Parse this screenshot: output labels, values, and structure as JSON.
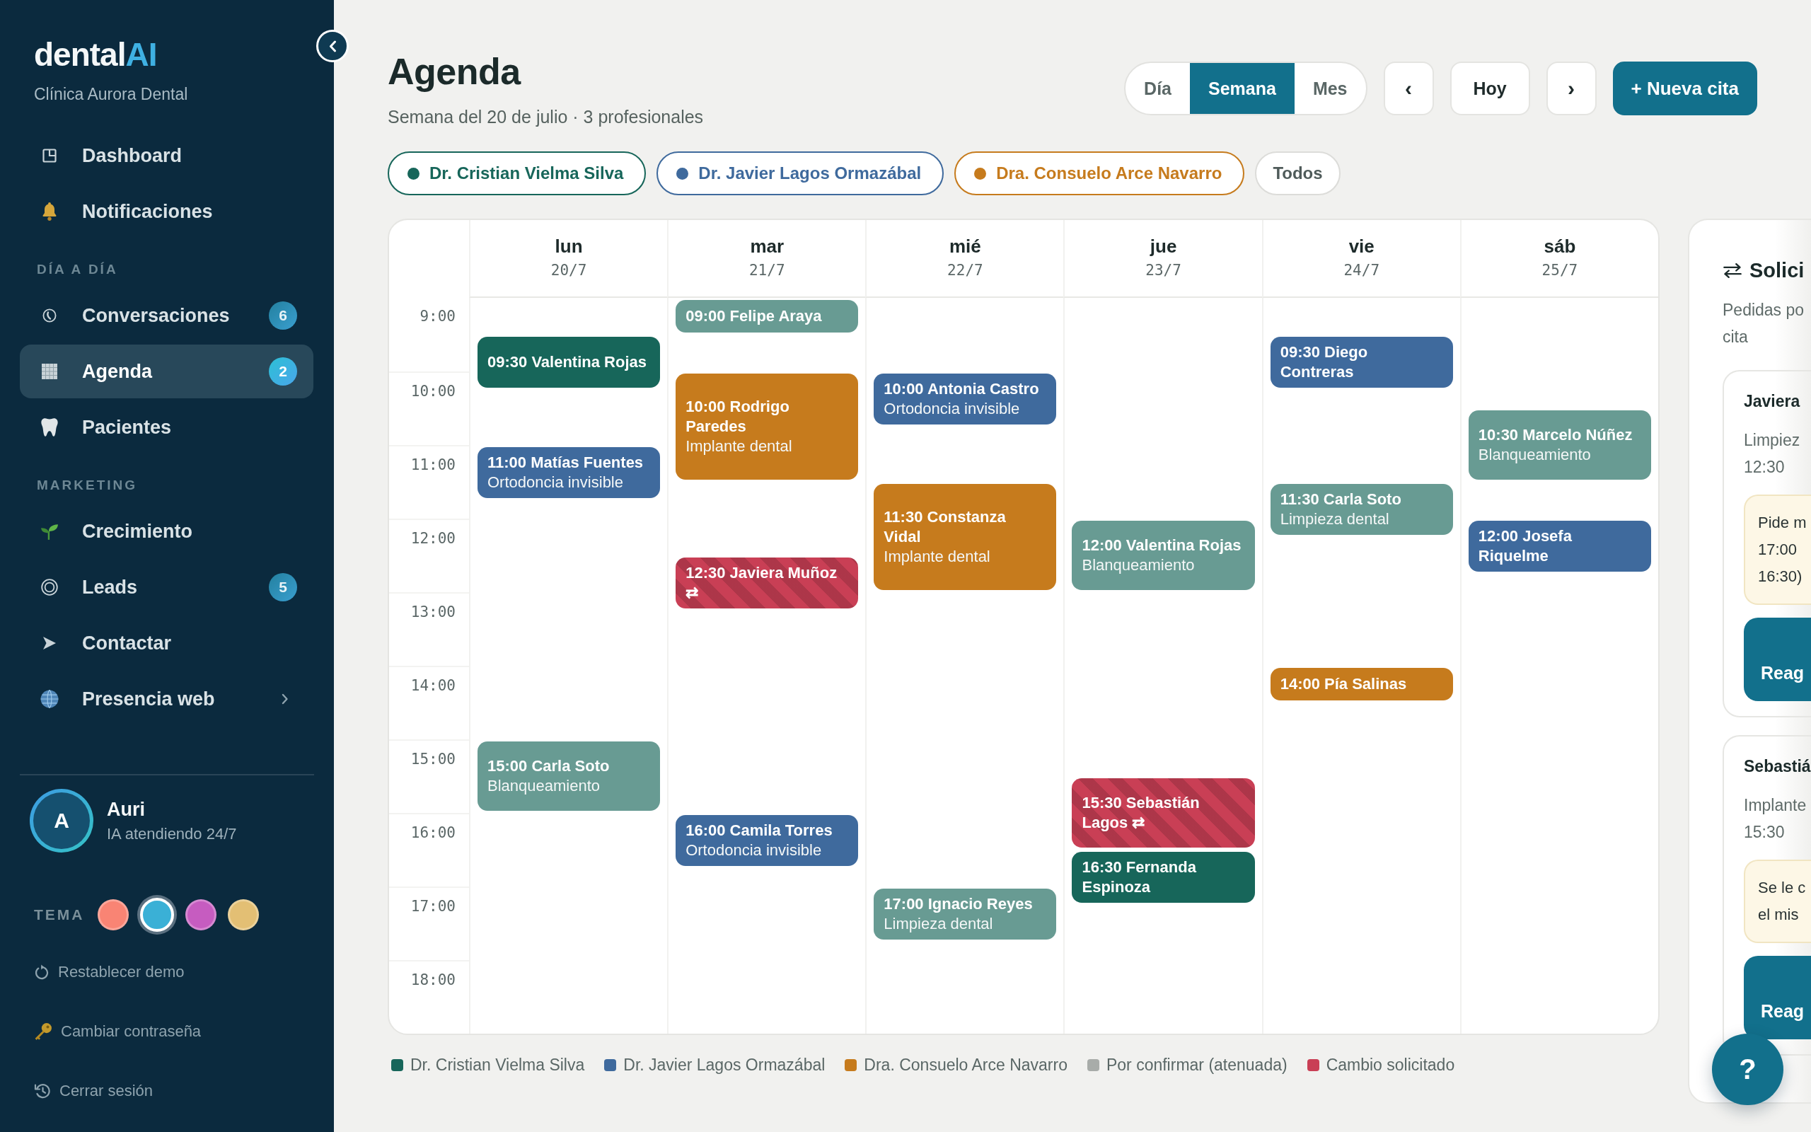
{
  "sidebar": {
    "logo": {
      "text": "dental",
      "accent": "AI"
    },
    "clinic": "Clínica Aurora Dental",
    "nav": [
      {
        "items": [
          {
            "label": "Dashboard",
            "selected": false,
            "submenu": false
          },
          {
            "label": "Notificaciones",
            "selected": false,
            "submenu": false
          }
        ]
      },
      {
        "label": "DÍA A DÍA",
        "items": [
          {
            "label": "Conversaciones",
            "badge": "6",
            "selected": false,
            "submenu": false
          },
          {
            "label": "Agenda",
            "badge": "2",
            "selected": true,
            "submenu": false
          },
          {
            "label": "Pacientes",
            "selected": false,
            "submenu": false
          }
        ]
      },
      {
        "label": "MARKETING",
        "items": [
          {
            "label": "Crecimiento",
            "selected": false,
            "submenu": false
          },
          {
            "label": "Leads",
            "badge": "5",
            "selected": false,
            "submenu": false
          },
          {
            "label": "Contactar",
            "selected": false,
            "submenu": false
          },
          {
            "label": "Presencia web",
            "selected": false,
            "submenu": true
          }
        ]
      }
    ],
    "profile": {
      "initial": "A",
      "name": "Auri",
      "status": "IA atendiendo 24/7"
    },
    "theme": {
      "label": "TEMA",
      "swatches": [
        {
          "color": "#f98474",
          "selected": false
        },
        {
          "color": "#3ab0d6",
          "selected": true
        },
        {
          "color": "#c65cc0",
          "selected": false
        },
        {
          "color": "#e3bf74",
          "selected": false
        }
      ]
    },
    "links": [
      {
        "label": "Restablecer demo"
      },
      {
        "label": "Cambiar contraseña"
      },
      {
        "label": "Cerrar sesión"
      }
    ]
  },
  "header": {
    "title": "Agenda",
    "subtitle": "Semana del 20 de julio · 3 profesionales",
    "views": [
      {
        "label": "Día",
        "selected": false
      },
      {
        "label": "Semana",
        "selected": true
      },
      {
        "label": "Mes",
        "selected": false
      }
    ],
    "prev": "‹",
    "today": "Hoy",
    "next": "›",
    "new_appointment": "+ Nueva cita"
  },
  "filters": [
    {
      "label": "Dr. Cristian Vielma Silva",
      "color": "#17665a",
      "selected": true
    },
    {
      "label": "Dr. Javier Lagos Ormazábal",
      "color": "#3f6a9d",
      "selected": true
    },
    {
      "label": "Dra. Consuelo Arce Navarro",
      "color": "#c67b1d",
      "selected": true
    },
    {
      "label": "Todos",
      "selected": false
    }
  ],
  "calendar": {
    "hours": [
      "9:00",
      "10:00",
      "11:00",
      "12:00",
      "13:00",
      "14:00",
      "15:00",
      "16:00",
      "17:00",
      "18:00"
    ],
    "days": [
      {
        "name": "lun",
        "date": "20/7",
        "events": [
          {
            "time": "09:30",
            "patient": "Valentina Rojas",
            "kind": "medium",
            "color": "#17665a",
            "change_requested": false
          },
          {
            "time": "11:00",
            "patient": "Matías Fuentes",
            "treatment": "Ortodoncia invisible",
            "kind": "medium",
            "color": "#3f6a9d",
            "change_requested": false
          },
          {
            "time": "15:00",
            "patient": "Carla Soto",
            "treatment": "Blanqueamiento",
            "kind": "long",
            "color": "#689b93",
            "change_requested": false
          }
        ]
      },
      {
        "name": "mar",
        "date": "21/7",
        "events": [
          {
            "time": "09:00",
            "patient": "Felipe Araya",
            "kind": "short",
            "color": "#689b93",
            "change_requested": false
          },
          {
            "time": "10:00",
            "patient": "Rodrigo Paredes",
            "treatment": "Implante dental",
            "kind": "extended",
            "color": "#c67b1d",
            "change_requested": false
          },
          {
            "time": "12:30",
            "patient": "Javiera Muñoz",
            "flag": "⇄",
            "kind": "medium",
            "color": "#c93f55",
            "change_requested": true
          },
          {
            "time": "16:00",
            "patient": "Camila Torres",
            "treatment": "Ortodoncia invisible",
            "kind": "medium",
            "color": "#3f6a9d",
            "change_requested": false
          }
        ]
      },
      {
        "name": "mié",
        "date": "22/7",
        "events": [
          {
            "time": "10:00",
            "patient": "Antonia Castro",
            "treatment": "Ortodoncia invisible",
            "kind": "medium",
            "color": "#3f6a9d",
            "change_requested": false
          },
          {
            "time": "11:30",
            "patient": "Constanza Vidal",
            "treatment": "Implante dental",
            "kind": "extended",
            "color": "#c67b1d",
            "change_requested": false
          },
          {
            "time": "17:00",
            "patient": "Ignacio Reyes",
            "treatment": "Limpieza dental",
            "kind": "medium",
            "color": "#689b93",
            "change_requested": false
          }
        ]
      },
      {
        "name": "jue",
        "date": "23/7",
        "events": [
          {
            "time": "12:00",
            "patient": "Valentina Rojas",
            "treatment": "Blanqueamiento",
            "kind": "long",
            "color": "#689b93",
            "change_requested": false
          },
          {
            "time": "15:30",
            "patient": "Sebastián Lagos",
            "flag": "⇄",
            "kind": "long",
            "color": "#c93f55",
            "change_requested": true
          },
          {
            "time": "16:30",
            "patient": "Fernanda Espinoza",
            "kind": "medium",
            "color": "#17665a",
            "change_requested": false
          }
        ]
      },
      {
        "name": "vie",
        "date": "24/7",
        "events": [
          {
            "time": "09:30",
            "patient": "Diego Contreras",
            "kind": "medium",
            "color": "#3f6a9d",
            "change_requested": false
          },
          {
            "time": "11:30",
            "patient": "Carla Soto",
            "treatment": "Limpieza dental",
            "kind": "medium",
            "color": "#689b93",
            "change_requested": false
          },
          {
            "time": "14:00",
            "patient": "Pía Salinas",
            "kind": "short",
            "color": "#c67b1d",
            "change_requested": false
          }
        ]
      },
      {
        "name": "sáb",
        "date": "25/7",
        "events": [
          {
            "time": "10:30",
            "patient": "Marcelo Núñez",
            "treatment": "Blanqueamiento",
            "kind": "long",
            "color": "#689b93",
            "change_requested": false
          },
          {
            "time": "12:00",
            "patient": "Josefa Riquelme",
            "kind": "medium",
            "color": "#3f6a9d",
            "change_requested": false
          }
        ]
      }
    ]
  },
  "legend": [
    {
      "label": "Dr. Cristian Vielma Silva",
      "color": "#17665a"
    },
    {
      "label": "Dr. Javier Lagos Ormazábal",
      "color": "#3f6a9d"
    },
    {
      "label": "Dra. Consuelo Arce Navarro",
      "color": "#c67b1d"
    },
    {
      "label": "Por confirmar (atenuada)",
      "color": "#a8aca9"
    },
    {
      "label": "Cambio solicitado",
      "color": "#c93f55"
    }
  ],
  "requests": {
    "title": "Solici",
    "description": "Pedidas po\ncita",
    "items": [
      {
        "name": "Javiera",
        "detail": "Limpiez\n12:30",
        "note": "Pide m\n17:00\n16:30)",
        "action": "Reag"
      },
      {
        "name": "Sebastiá",
        "detail": "Implante\n15:30",
        "note": "Se le c\nel mis",
        "action": "Reag"
      }
    ]
  },
  "help": "?"
}
